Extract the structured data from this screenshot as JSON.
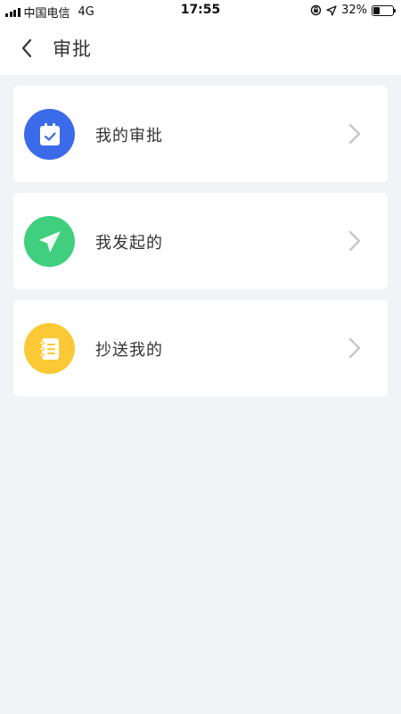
{
  "status_bar": {
    "carrier": "中国电信",
    "network": "4G",
    "time": "17:55",
    "battery": "32%",
    "battery_level": 0.32
  },
  "nav": {
    "title": "审批",
    "back_icon": "chevron-left-icon"
  },
  "items": [
    {
      "label": "我的审批",
      "icon": "calendar-check-icon",
      "color": "#3b6be8"
    },
    {
      "label": "我发起的",
      "icon": "paper-plane-icon",
      "color": "#3fcf7e"
    },
    {
      "label": "抄送我的",
      "icon": "notebook-icon",
      "color": "#fbc936"
    }
  ],
  "colors": {
    "background": "#f2f3f7",
    "card": "#ffffff",
    "chevron": "#c4c7cf"
  }
}
